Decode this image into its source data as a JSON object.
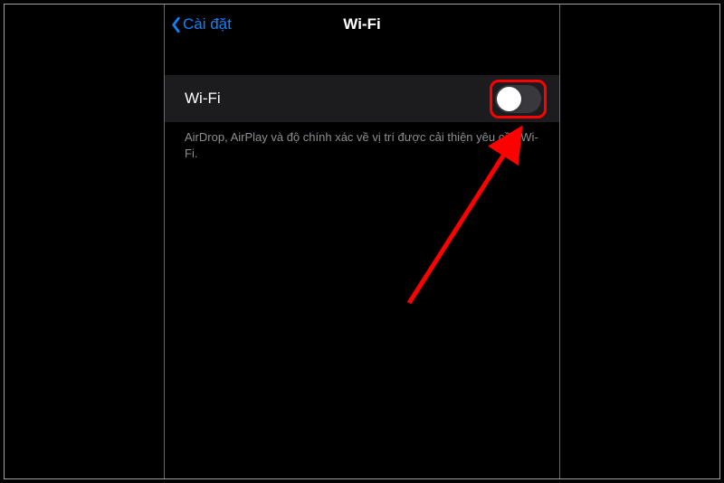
{
  "nav": {
    "back_label": "Cài đặt",
    "title": "Wi-Fi"
  },
  "wifi_row": {
    "label": "Wi-Fi",
    "enabled": false
  },
  "description": "AirDrop, AirPlay và độ chính xác về vị trí được cải thiện yêu cầu Wi-Fi."
}
